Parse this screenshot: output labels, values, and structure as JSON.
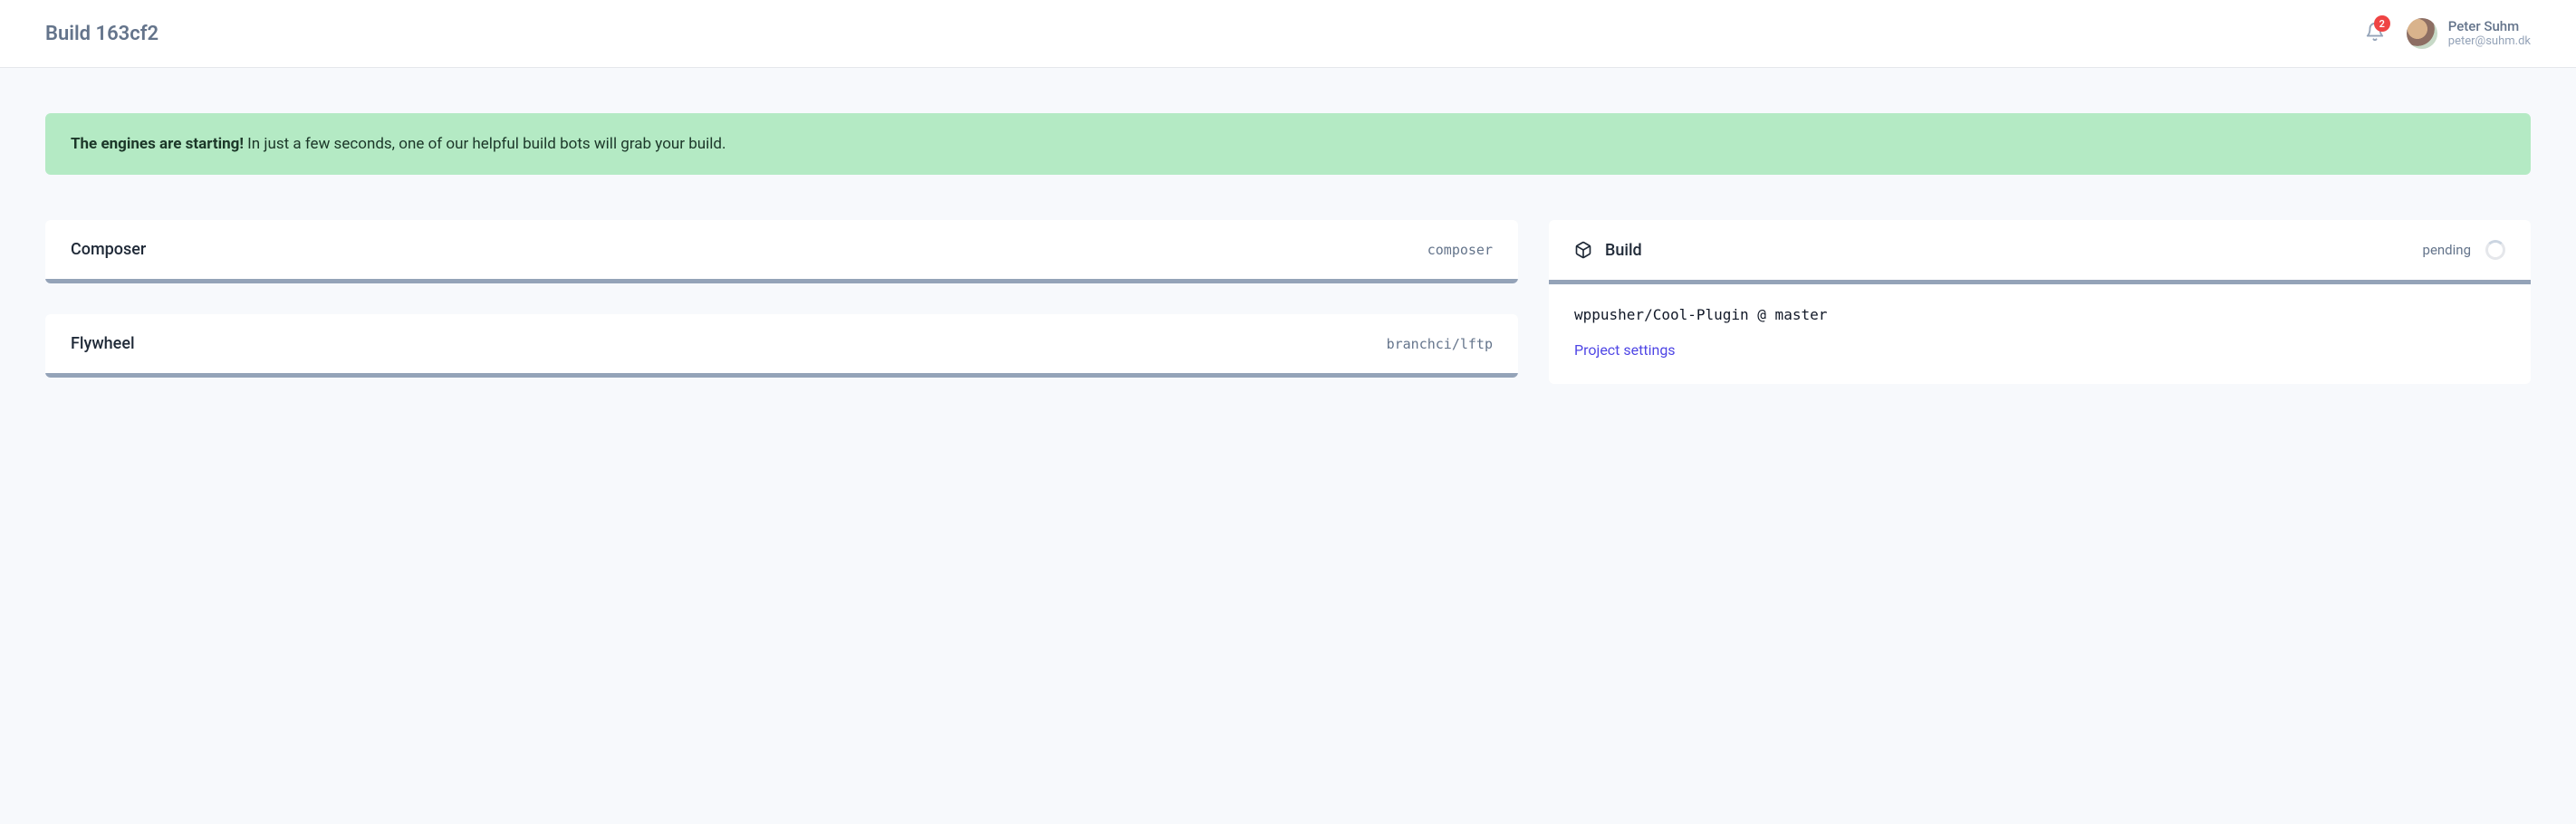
{
  "header": {
    "title": "Build 163cf2",
    "notifications": {
      "count": "2"
    },
    "user": {
      "name": "Peter Suhm",
      "email": "peter@suhm.dk"
    }
  },
  "alert": {
    "bold": "The engines are starting!",
    "text": " In just a few seconds, one of our helpful build bots will grab your build."
  },
  "stages": [
    {
      "title": "Composer",
      "meta": "composer"
    },
    {
      "title": "Flywheel",
      "meta": "branchci/lftp"
    }
  ],
  "build_panel": {
    "title": "Build",
    "status": "pending",
    "repo": "wppusher/Cool-Plugin @ master",
    "settings_label": "Project settings"
  }
}
